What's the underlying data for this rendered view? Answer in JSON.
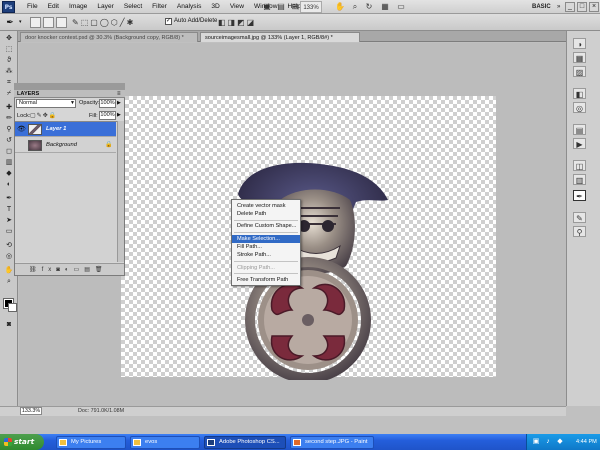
{
  "app": {
    "logo_text": "Ps",
    "zoom_label": "133%",
    "workspace_label": "BASIC"
  },
  "menu": [
    "File",
    "Edit",
    "Image",
    "Layer",
    "Select",
    "Filter",
    "Analysis",
    "3D",
    "View",
    "Window",
    "Help"
  ],
  "options_bar": {
    "auto_add_delete_label": "Auto Add/Delete",
    "auto_add_delete_checked": true
  },
  "tabs": [
    {
      "label": "door knocker contest.psd @ 30.3% (Background copy, RGB/8) *",
      "active": false
    },
    {
      "label": "sourceimagesmall.jpg @ 133% (Layer 1, RGB/8#) *",
      "active": true
    }
  ],
  "layers_panel": {
    "title": "LAYERS",
    "blend_mode": "Normal",
    "opacity_label": "Opacity:",
    "opacity_value": "100%",
    "lock_label": "Lock:",
    "fill_label": "Fill:",
    "fill_value": "100%",
    "layers": [
      {
        "name": "Layer 1",
        "selected": true,
        "visible": true
      },
      {
        "name": "Background",
        "selected": false,
        "visible": false,
        "locked": true
      }
    ]
  },
  "context_menu": {
    "items": [
      {
        "label": "Create vector mask",
        "state": "normal"
      },
      {
        "label": "Delete Path",
        "state": "normal"
      },
      {
        "label": "Define Custom Shape...",
        "state": "normal"
      },
      {
        "label": "Make Selection...",
        "state": "highlighted"
      },
      {
        "label": "Fill Path...",
        "state": "normal"
      },
      {
        "label": "Stroke Path...",
        "state": "normal"
      },
      {
        "label": "Clipping Path...",
        "state": "disabled"
      },
      {
        "label": "Free Transform Path",
        "state": "normal"
      }
    ]
  },
  "status_bar": {
    "zoom": "133.3%",
    "doc": "Doc: 791.0K/1.08M"
  },
  "taskbar": {
    "start_label": "start",
    "items": [
      {
        "label": "My Pictures",
        "active": false
      },
      {
        "label": "evos",
        "active": false
      },
      {
        "label": "Adobe Photoshop CS...",
        "active": true
      },
      {
        "label": "second step.JPG - Paint",
        "active": false
      }
    ],
    "clock": "4:44 PM"
  },
  "colors": {
    "accent_blue": "#316ac5",
    "taskbar_blue": "#245edb",
    "start_green": "#2f8a2f",
    "layer_selected": "#3a6fd8"
  }
}
